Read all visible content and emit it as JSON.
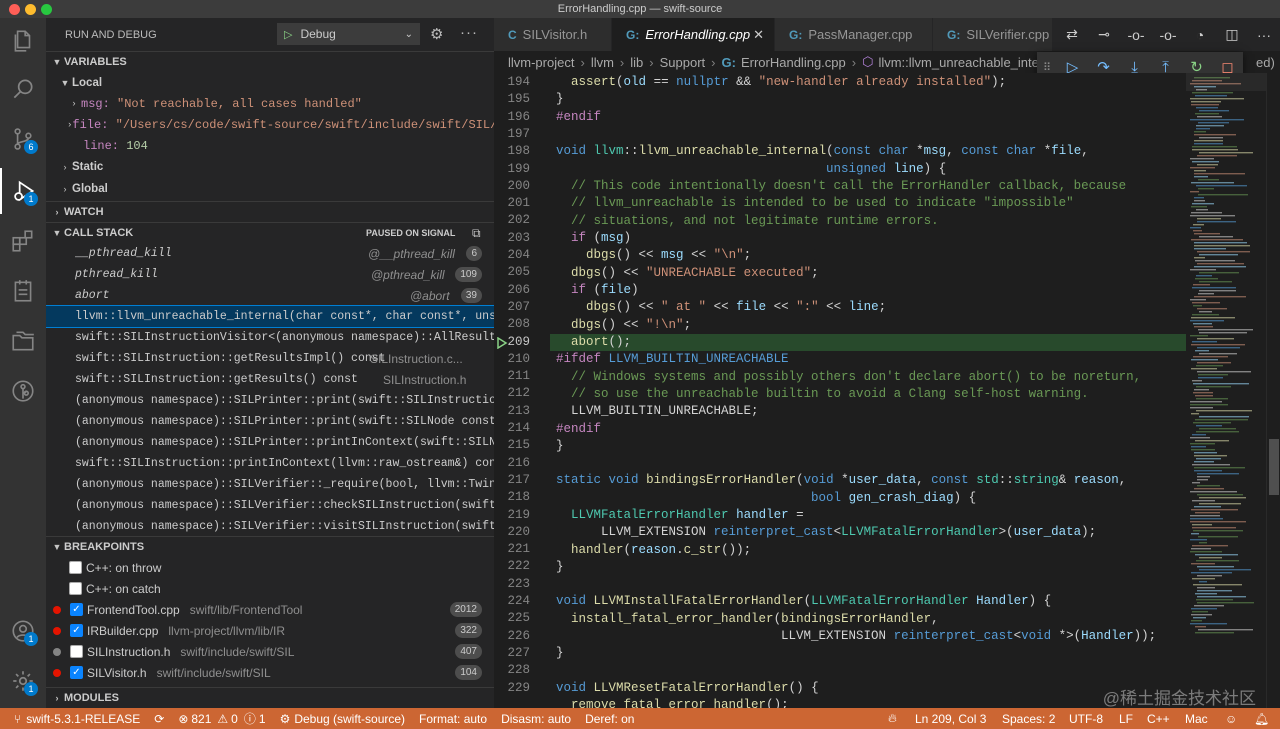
{
  "window": {
    "title": "ErrorHandling.cpp — swift-source"
  },
  "activity": {
    "scm_badge": "6",
    "debug_badge": "1",
    "accounts_badge": "1",
    "settings_badge": "1"
  },
  "sidebar": {
    "title": "RUN AND DEBUG",
    "config": "Debug",
    "variables": {
      "header": "VARIABLES",
      "local_label": "Local",
      "locals": [
        {
          "name": "msg:",
          "value": "\"Not reachable, all cases handled\""
        },
        {
          "name": "file:",
          "value": "\"/Users/cs/code/swift-source/swift/include/swift/SIL/SILV..."
        },
        {
          "name": "line:",
          "value": "104"
        }
      ],
      "static_label": "Static",
      "global_label": "Global"
    },
    "watch_header": "WATCH",
    "callstack": {
      "header": "CALL STACK",
      "status": "PAUSED ON SIGNAL",
      "frames": [
        {
          "fn": "__pthread_kill",
          "src": "@__pthread_kill",
          "line": "6"
        },
        {
          "fn": "pthread_kill",
          "src": "@pthread_kill",
          "line": "109"
        },
        {
          "fn": "abort",
          "src": "@abort",
          "line": "39"
        },
        {
          "fn": "llvm::llvm_unreachable_internal(char const*, char const*, unsigned",
          "src": "",
          "line": ""
        },
        {
          "fn": "swift::SILInstructionVisitor<(anonymous namespace)::AllResultsAcce",
          "src": "",
          "line": ""
        },
        {
          "fn": "swift::SILInstruction::getResultsImpl() const",
          "src": "SILInstruction.c...",
          "line": ""
        },
        {
          "fn": "swift::SILInstruction::getResults() const",
          "src": "SILInstruction.h",
          "line": ""
        },
        {
          "fn": "(anonymous namespace)::SILPrinter::print(swift::SILInstruction con",
          "src": "",
          "line": ""
        },
        {
          "fn": "(anonymous namespace)::SILPrinter::print(swift::SILNode const*)",
          "src": "",
          "line": ""
        },
        {
          "fn": "(anonymous namespace)::SILPrinter::printInContext(swift::SILNode c",
          "src": "",
          "line": ""
        },
        {
          "fn": "swift::SILInstruction::printInContext(llvm::raw_ostream&) const",
          "src": "",
          "line": ""
        },
        {
          "fn": "(anonymous namespace)::SILVerifier::_require(bool, llvm::Twine con",
          "src": "",
          "line": ""
        },
        {
          "fn": "(anonymous namespace)::SILVerifier::checkSILInstruction(swift::SIL",
          "src": "",
          "line": ""
        },
        {
          "fn": "(anonymous namespace)::SILVerifier::visitSILInstruction(swift::SIL",
          "src": "",
          "line": ""
        }
      ]
    },
    "breakpoints": {
      "header": "BREAKPOINTS",
      "items": [
        {
          "label": "C++: on throw",
          "path": "",
          "count": ""
        },
        {
          "label": "C++: on catch",
          "path": "",
          "count": ""
        },
        {
          "label": "FrontendTool.cpp",
          "path": "swift/lib/FrontendTool",
          "count": "2012"
        },
        {
          "label": "IRBuilder.cpp",
          "path": "llvm-project/llvm/lib/IR",
          "count": "322"
        },
        {
          "label": "SILInstruction.h",
          "path": "swift/include/swift/SIL",
          "count": "407"
        },
        {
          "label": "SILVisitor.h",
          "path": "swift/include/swift/SIL",
          "count": "104"
        }
      ]
    },
    "modules_header": "MODULES"
  },
  "tabs": [
    {
      "label": "SILVisitor.h"
    },
    {
      "label": "ErrorHandling.cpp"
    },
    {
      "label": "PassManager.cpp"
    },
    {
      "label": "SILVerifier.cpp"
    }
  ],
  "breadcrumb": [
    "llvm-project",
    "llvm",
    "lib",
    "Support",
    "ErrorHandling.cpp",
    "llvm::llvm_unreachable_inter",
    "ed)"
  ],
  "editor": {
    "line_numbers": [
      "194",
      "195",
      "196",
      "197",
      "198",
      "199",
      "200",
      "201",
      "202",
      "203",
      "204",
      "205",
      "206",
      "207",
      "208",
      "209",
      "210",
      "211",
      "212",
      "213",
      "214",
      "215",
      "216",
      "217",
      "218",
      "219",
      "220",
      "221",
      "222",
      "223",
      "224",
      "225",
      "226",
      "227",
      "228",
      "229"
    ],
    "current_line": "209"
  },
  "statusbar": {
    "branch": "swift-5.3.1-RELEASE",
    "errors": "821",
    "warnings": "0",
    "infos": "1",
    "debug": "Debug (swift-source)",
    "format": "Format: auto",
    "disasm": "Disasm: auto",
    "deref": "Deref: on",
    "position": "Ln 209, Col 3",
    "spaces": "Spaces: 2",
    "encoding": "UTF-8",
    "eol": "LF",
    "language": "C++",
    "keymap": "Mac"
  },
  "watermark": "@稀土掘金技术社区",
  "colors": {
    "statusbar": "#cc6633",
    "accent": "#007acc",
    "current_line": "#284a2c"
  }
}
